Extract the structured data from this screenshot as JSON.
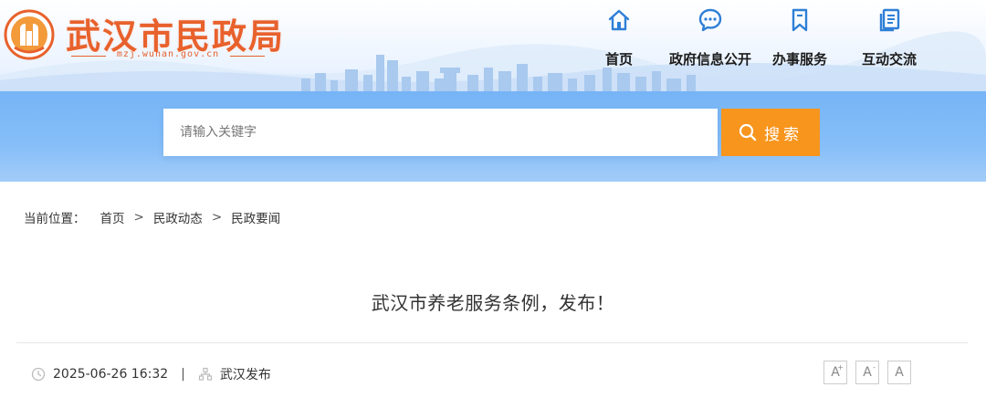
{
  "brand": {
    "title": "武汉市民政局",
    "url": "mzj.wuhan.gov.cn",
    "accent_color": "#e8612c"
  },
  "nav": {
    "items": [
      {
        "label": "首页",
        "icon": "home-icon"
      },
      {
        "label": "政府信息公开",
        "icon": "chat-bubble-icon"
      },
      {
        "label": "办事服务",
        "icon": "bookmark-icon"
      },
      {
        "label": "互动交流",
        "icon": "document-icon"
      }
    ],
    "icon_color": "#2f7fd6"
  },
  "search": {
    "placeholder": "请输入关键字",
    "button_label": "搜索",
    "button_color": "#f7951d"
  },
  "breadcrumb": {
    "label": "当前位置：",
    "items": [
      "首页",
      "民政动态",
      "民政要闻"
    ],
    "separator": ">"
  },
  "article": {
    "title": "武汉市养老服务条例，发布！",
    "date": "2025-06-26 16:32",
    "source": "武汉发布",
    "meta_separator": "|"
  },
  "font_size_controls": {
    "increase": "A",
    "increase_sup": "+",
    "decrease": "A",
    "decrease_sup": "-",
    "reset": "A"
  }
}
